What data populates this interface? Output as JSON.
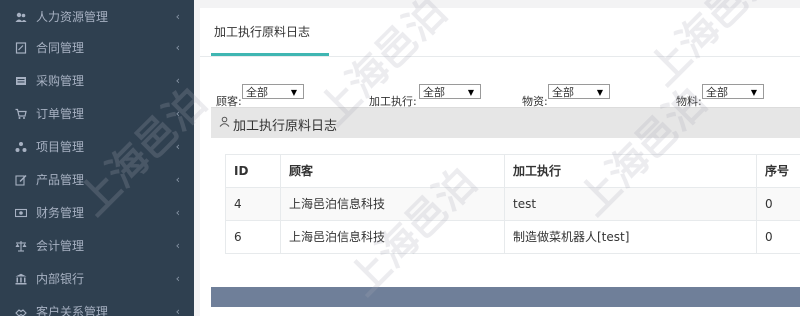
{
  "sidebar": {
    "items": [
      {
        "label": "人力资源管理",
        "icon": "users-icon"
      },
      {
        "label": "合同管理",
        "icon": "contract-icon"
      },
      {
        "label": "采购管理",
        "icon": "purchase-icon"
      },
      {
        "label": "订单管理",
        "icon": "cart-icon"
      },
      {
        "label": "项目管理",
        "icon": "sitemap-icon"
      },
      {
        "label": "产品管理",
        "icon": "edit-icon"
      },
      {
        "label": "财务管理",
        "icon": "money-icon"
      },
      {
        "label": "会计管理",
        "icon": "balance-icon"
      },
      {
        "label": "内部银行",
        "icon": "bank-icon"
      },
      {
        "label": "客户关系管理",
        "icon": "handshake-icon"
      }
    ]
  },
  "tab": {
    "label": "加工执行原料日志"
  },
  "filters": [
    {
      "label": "顾客:",
      "value": "全部"
    },
    {
      "label": "加工执行:",
      "value": "全部"
    },
    {
      "label": "物资:",
      "value": "全部"
    },
    {
      "label": "物料:",
      "value": "全部"
    }
  ],
  "section": {
    "title": "加工执行原料日志"
  },
  "table": {
    "headers": [
      "ID",
      "顾客",
      "加工执行",
      "序号"
    ],
    "rows": [
      [
        "4",
        "上海邑泊信息科技",
        "test",
        "0"
      ],
      [
        "6",
        "上海邑泊信息科技",
        "制造做菜机器人[test]",
        "0"
      ]
    ]
  },
  "watermark": "上海邑泊"
}
